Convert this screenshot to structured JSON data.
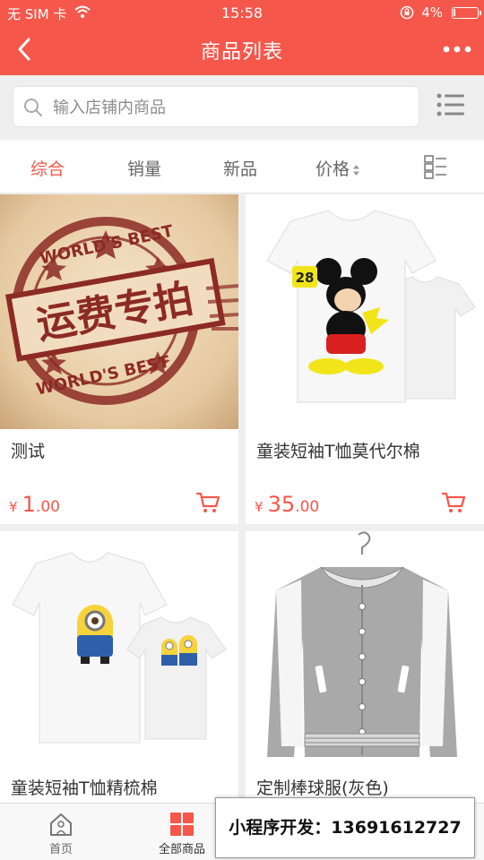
{
  "status": {
    "carrier": "无 SIM 卡",
    "time": "15:58",
    "battery": "4%",
    "battery_level": 0.04
  },
  "nav": {
    "title": "商品列表"
  },
  "search": {
    "placeholder": "输入店铺内商品"
  },
  "tabs": [
    {
      "label": "综合",
      "active": true
    },
    {
      "label": "销量",
      "active": false
    },
    {
      "label": "新品",
      "active": false
    },
    {
      "label": "价格",
      "active": false
    }
  ],
  "products": [
    {
      "name": "测试",
      "currency": "¥",
      "price_int": "1",
      "price_dec": ".00",
      "image_text": "运费专拍",
      "stamp_text": "WORLD'S BEST"
    },
    {
      "name": "童装短袖T恤莫代尔棉",
      "currency": "¥",
      "price_int": "35",
      "price_dec": ".00"
    },
    {
      "name": "童装短袖T恤精梳棉"
    },
    {
      "name": "定制棒球服(灰色)"
    }
  ],
  "tabbar": {
    "items": [
      {
        "label": "首页"
      },
      {
        "label": "全部商品"
      }
    ]
  },
  "promo": {
    "text": "小程序开发：13691612727"
  },
  "colors": {
    "brand": "#f5574b",
    "background": "#efefef"
  }
}
